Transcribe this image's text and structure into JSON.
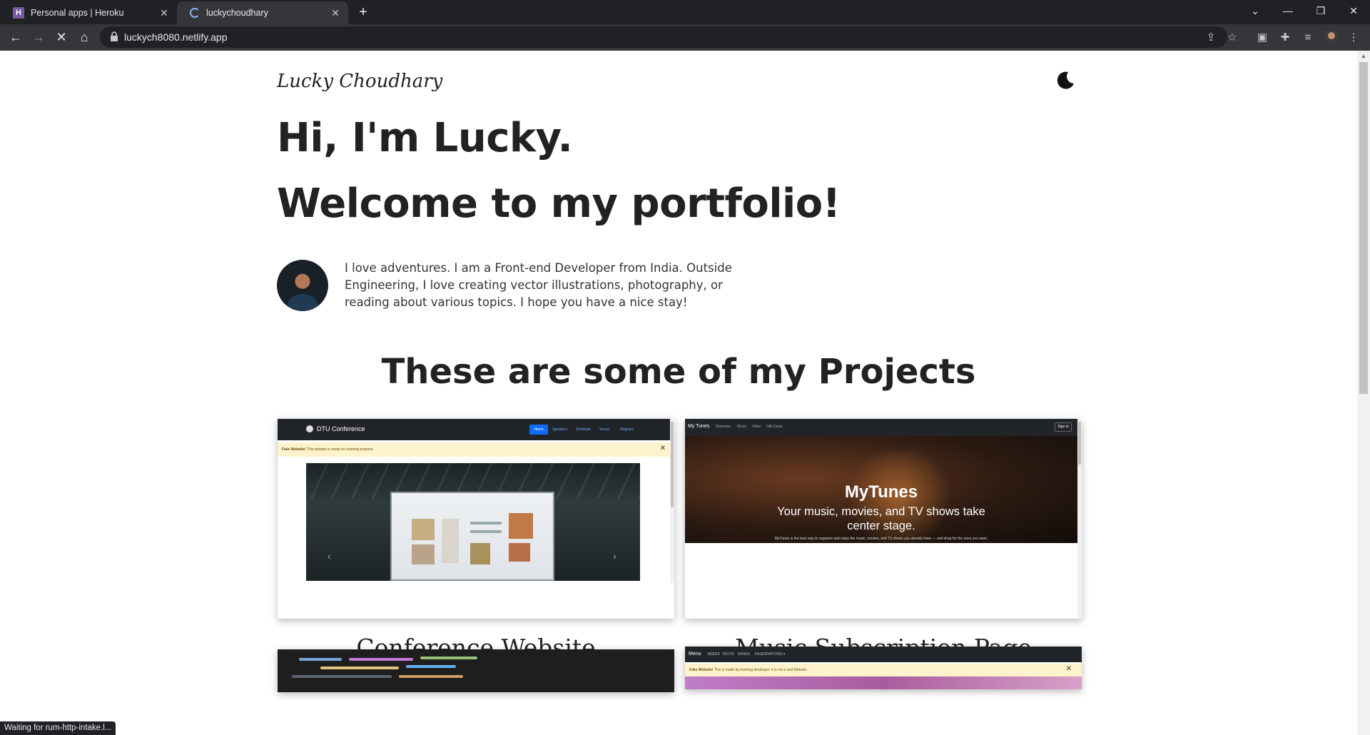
{
  "browser": {
    "tabs": [
      {
        "title": "Personal apps | Heroku",
        "favicon": "heroku-icon"
      },
      {
        "title": "luckychoudhary",
        "favicon": "loading-spinner-icon"
      }
    ],
    "url": "luckych8080.netlify.app",
    "status_text": "Waiting for rum-http-intake.l..."
  },
  "site": {
    "brand": "Lucky Choudhary",
    "hero_line1": "Hi, I'm Lucky.",
    "hero_line2": "Welcome to my portfolio!",
    "bio": "I love adventures. I am a Front-end Developer from India. Outside Engineering, I love creating vector illustrations, photography, or reading about various topics. I hope you have a nice stay!",
    "projects_title": "These are some of my Projects"
  },
  "projects": [
    {
      "caption": "Conference Website",
      "preview": {
        "brand": "DTU Conference",
        "nav": [
          "Home",
          "Speakers",
          "Schedule",
          "Venue",
          "Register"
        ],
        "alert_bold": "Fake Website!",
        "alert_text": "This website is made for learning purpose."
      }
    },
    {
      "caption": "Music Subscription Page",
      "preview": {
        "brand": "My Tunes",
        "nav": [
          "Overview",
          "Music",
          "Video",
          "Gift Cards"
        ],
        "sign_in": "Sign in",
        "title": "MyTunes",
        "subtitle": "Your music, movies, and TV shows take center stage.",
        "small": "MyTunes is the best way to organize and enjoy the music, movies, and TV shows you already have — and shop for the ones you want."
      }
    },
    {
      "caption": "",
      "preview": {}
    },
    {
      "caption": "",
      "preview": {
        "brand": "Menu",
        "nav": [
          "BEERS",
          "TACOS",
          "WINGS",
          "RESERVATIONS ▾"
        ],
        "alert_bold": "Fake Website!",
        "alert_text": "This is made by learning developer. It is not a real Website."
      }
    }
  ]
}
